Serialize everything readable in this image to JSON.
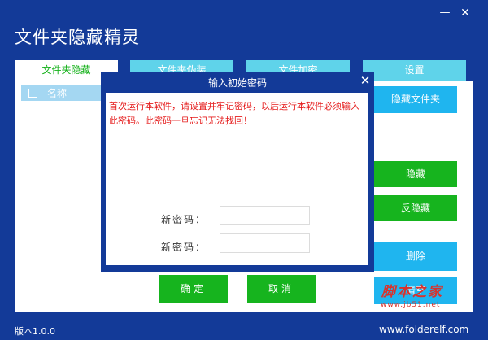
{
  "window": {
    "title": "文件夹隐藏精灵",
    "minimize": "—",
    "close": "✕"
  },
  "tabs": [
    {
      "label": "文件夹隐藏",
      "active": true
    },
    {
      "label": "文件夹伪装",
      "active": false
    },
    {
      "label": "文件加密",
      "active": false
    },
    {
      "label": "设置",
      "active": false
    }
  ],
  "list": {
    "column_name": "名称"
  },
  "side_buttons": {
    "hide_folder": "隐藏文件夹",
    "hide": "隐藏",
    "unhide": "反隐藏",
    "delete": "删除",
    "other": "清空"
  },
  "dialog": {
    "title": "输入初始密码",
    "close": "✕",
    "message": "首次运行本软件，请设置并牢记密码，以后运行本软件必须输入此密码。此密码一旦忘记无法找回！",
    "new_password_label": "新密码：",
    "confirm_password_label": "新密码：",
    "new_password_value": "",
    "confirm_password_value": "",
    "ok": "确定",
    "cancel": "取消"
  },
  "watermark": {
    "main": "脚本之家",
    "sub": "www.jb51.net"
  },
  "status": {
    "version": "版本1.0.0",
    "website": "www.folderelf.com"
  },
  "colors": {
    "frame": "#133a98",
    "tab": "#5fd3ea",
    "active_tab_text": "#14b11a",
    "green_button": "#16b41e",
    "blue_button": "#1fb5ef",
    "warning_text": "#e51b1b"
  }
}
